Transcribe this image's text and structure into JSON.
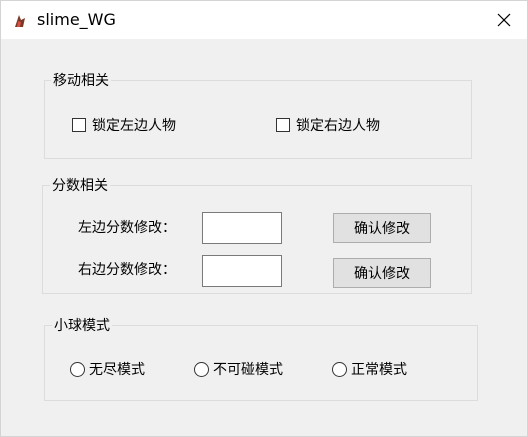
{
  "window": {
    "title": "slime_WG"
  },
  "move_group": {
    "legend": "移动相关",
    "lock_left": {
      "label": "锁定左边人物",
      "checked": false
    },
    "lock_right": {
      "label": "锁定右边人物",
      "checked": false
    }
  },
  "score_group": {
    "legend": "分数相关",
    "left_label": "左边分数修改：",
    "left_value": "",
    "left_button": "确认修改",
    "right_label": "右边分数修改：",
    "right_value": "",
    "right_button": "确认修改"
  },
  "ball_group": {
    "legend": "小球模式",
    "options": [
      "无尽模式",
      "不可碰模式",
      "正常模式"
    ]
  }
}
